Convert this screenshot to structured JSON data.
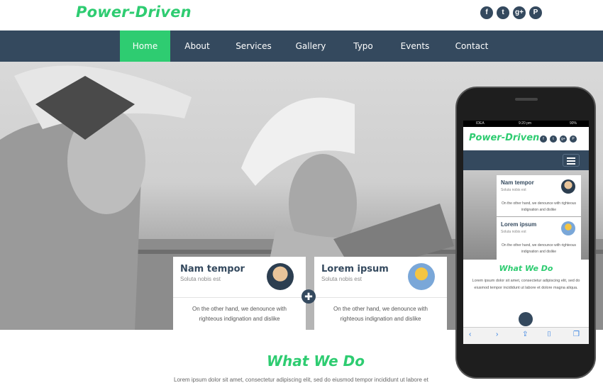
{
  "header": {
    "logo": "Power-Driven",
    "social": [
      {
        "icon": "facebook-icon",
        "glyph": "f"
      },
      {
        "icon": "twitter-icon",
        "glyph": "t"
      },
      {
        "icon": "googleplus-icon",
        "glyph": "g+"
      },
      {
        "icon": "pinterest-icon",
        "glyph": "P"
      }
    ]
  },
  "nav": {
    "items": [
      {
        "label": "Home",
        "active": true
      },
      {
        "label": "About"
      },
      {
        "label": "Services"
      },
      {
        "label": "Gallery"
      },
      {
        "label": "Typo"
      },
      {
        "label": "Events"
      },
      {
        "label": "Contact"
      }
    ]
  },
  "cards": [
    {
      "title": "Nam tempor",
      "subtitle": "Soluta nobis est",
      "body": "On the other hand, we denounce with righteous indignation and dislike"
    },
    {
      "title": "Lorem ipsum",
      "subtitle": "Soluta nobis est",
      "body": "On the other hand, we denounce with righteous indignation and dislike"
    }
  ],
  "plus_glyph": "✚",
  "section": {
    "title": "What We Do",
    "text": "Lorem ipsum dolor sit amet, consectetur adipiscing elit, sed do eiusmod tempor incididunt ut labore et"
  },
  "phone": {
    "status": {
      "carrier": "IDEA",
      "time": "9:20 pm",
      "battery": "90%"
    },
    "logo": "Power-Driven",
    "cards": [
      {
        "title": "Nam tempor",
        "subtitle": "Soluta nobis est",
        "body": "On the other hand, we denounce with righteous indignation and dislike"
      },
      {
        "title": "Lorem ipsum",
        "subtitle": "Soluta nobis est",
        "body": "On the other hand, we denounce with righteous indignation and dislike"
      }
    ],
    "section_title": "What We Do",
    "section_text": "Lorem ipsum dolor sit amet, consectetur adipiscing elit, sed do eiusmod tempor incididunt ut labore et dolore magna aliqua.",
    "toolbar": {
      "back": "‹",
      "forward": "›",
      "share": "⇪",
      "bookmarks": "⌷",
      "tabs": "❐"
    }
  },
  "colors": {
    "accent": "#2ecc71",
    "nav": "#34495e"
  }
}
